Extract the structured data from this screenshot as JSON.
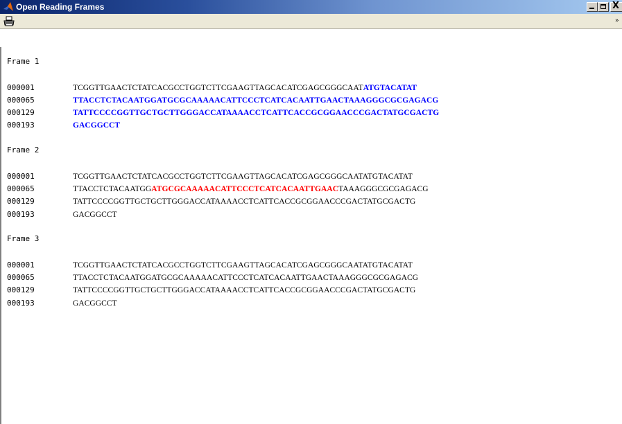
{
  "window": {
    "title": "Open Reading Frames",
    "controls": {
      "minimize": "_",
      "maximize": "□",
      "close": "X"
    }
  },
  "toolbar": {
    "print_icon": "printer-icon",
    "overflow_icon": "chevron-icon",
    "overflow_label": "»"
  },
  "colors": {
    "orf_frame1": "#0000ff",
    "orf_frame2": "#ff0000",
    "text": "#000000"
  },
  "frames": [
    {
      "title": "Frame 1",
      "lines": [
        {
          "pos": "000001",
          "plain": "TCGGTTGAACTCTATCACGCCTGGTCTTCGAAGTTAGCACATCGAGCGGGCAAT",
          "orf": "ATGTACATAT",
          "after": ""
        },
        {
          "pos": "000065",
          "plain": "",
          "orf": "TTACCTCTACAATGGATGCGCAAAAACATTCCCTCATCACAATTGAACTAAAGGGCGCGAGACG",
          "after": ""
        },
        {
          "pos": "000129",
          "plain": "",
          "orf": "TATTCCCCGGTTGCTGCTTGGGACCATAAAACCTCATTCACCGCGGAACCCGACTATGCGACTG",
          "after": ""
        },
        {
          "pos": "000193",
          "plain": "",
          "orf": "GACGGCCT",
          "after": ""
        }
      ]
    },
    {
      "title": "Frame 2",
      "lines": [
        {
          "pos": "000001",
          "plain": "TCGGTTGAACTCTATCACGCCTGGTCTTCGAAGTTAGCACATCGAGCGGGCAATATGTACATAT",
          "orf": "",
          "after": ""
        },
        {
          "pos": "000065",
          "plain": "TTACCTCTACAATGG",
          "orf": "ATGCGCAAAAACATTCCCTCATCACAATTGAAC",
          "after": "TAAAGGGCGCGAGACG"
        },
        {
          "pos": "000129",
          "plain": "TATTCCCCGGTTGCTGCTTGGGACCATAAAACCTCATTCACCGCGGAACCCGACTATGCGACTG",
          "orf": "",
          "after": ""
        },
        {
          "pos": "000193",
          "plain": "GACGGCCT",
          "orf": "",
          "after": ""
        }
      ]
    },
    {
      "title": "Frame 3",
      "lines": [
        {
          "pos": "000001",
          "plain": "TCGGTTGAACTCTATCACGCCTGGTCTTCGAAGTTAGCACATCGAGCGGGCAATATGTACATAT",
          "orf": "",
          "after": ""
        },
        {
          "pos": "000065",
          "plain": "TTACCTCTACAATGGATGCGCAAAAACATTCCCTCATCACAATTGAACTAAAGGGCGCGAGACG",
          "orf": "",
          "after": ""
        },
        {
          "pos": "000129",
          "plain": "TATTCCCCGGTTGCTGCTTGGGACCATAAAACCTCATTCACCGCGGAACCCGACTATGCGACTG",
          "orf": "",
          "after": ""
        },
        {
          "pos": "000193",
          "plain": "GACGGCCT",
          "orf": "",
          "after": ""
        }
      ]
    }
  ]
}
